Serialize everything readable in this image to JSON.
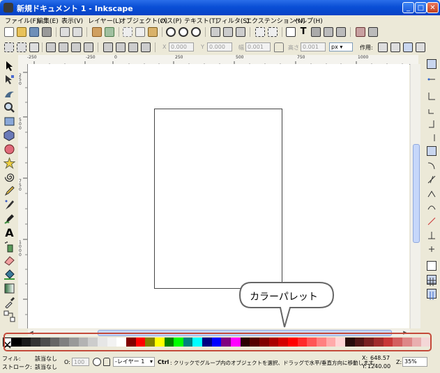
{
  "window": {
    "title": "新規ドキュメント 1 - Inkscape"
  },
  "menubar": [
    "ファイル(F)",
    "編集(E)",
    "表示(V)",
    "レイヤー(L)",
    "オブジェクト(O)",
    "パス(P)",
    "テキスト(T)",
    "フィルタ(S)",
    "エクステンション(N)",
    "ヘルプ(H)"
  ],
  "tool_controls": {
    "x_label": "X",
    "x_value": "0.000",
    "y_label": "Y",
    "y_value": "0.000",
    "w_label": "幅",
    "w_value": "0.001",
    "h_label": "高さ",
    "h_value": "0.001",
    "unit": "px",
    "affect_label": "作用:"
  },
  "hruler_labels": [
    "-250",
    "-250",
    "0",
    "250",
    "500",
    "750",
    "1000"
  ],
  "vruler_labels": [
    "250",
    "500",
    "750",
    "1000"
  ],
  "callout": {
    "text": "カラーパレット"
  },
  "palette": {
    "colors": [
      "#000000",
      "#1a1a1a",
      "#333333",
      "#4d4d4d",
      "#666666",
      "#808080",
      "#999999",
      "#b3b3b3",
      "#cccccc",
      "#e6e6e6",
      "#f2f2f2",
      "#ffffff",
      "#800000",
      "#ff0000",
      "#808000",
      "#ffff00",
      "#008000",
      "#00ff00",
      "#008080",
      "#00ffff",
      "#000080",
      "#0000ff",
      "#800080",
      "#ff00ff",
      "#2b0000",
      "#550000",
      "#800000",
      "#aa0000",
      "#d40000",
      "#ff0000",
      "#ff2a2a",
      "#ff5555",
      "#ff8080",
      "#ffaaaa",
      "#ffd5d5",
      "#280b0b",
      "#501616",
      "#782121",
      "#a02c2c",
      "#c83737",
      "#d35f5f",
      "#de8787",
      "#e9afaf",
      "#f4d7d7"
    ]
  },
  "status": {
    "fill_label": "フィル:",
    "fill_value": "該当なし",
    "stroke_label": "ストローク:",
    "stroke_value": "該当なし",
    "opacity_label": "O:",
    "opacity_value": "100",
    "layer": "-レイヤー 1",
    "hint_key": "Ctrl",
    "hint_text": ": クリックでグループ内のオブジェクトを選択、ドラッグで水平/垂直方向に移動します。",
    "x_label": "X:",
    "x_value": "648.57",
    "y_label": "Y:",
    "y_value": "1240.00",
    "zoom_label": "Z:",
    "zoom_value": "35%"
  },
  "colors": {
    "titlebar": "#0a4fd6",
    "ui_bg": "#ece9d8",
    "callout_border": "#c44a3a"
  }
}
